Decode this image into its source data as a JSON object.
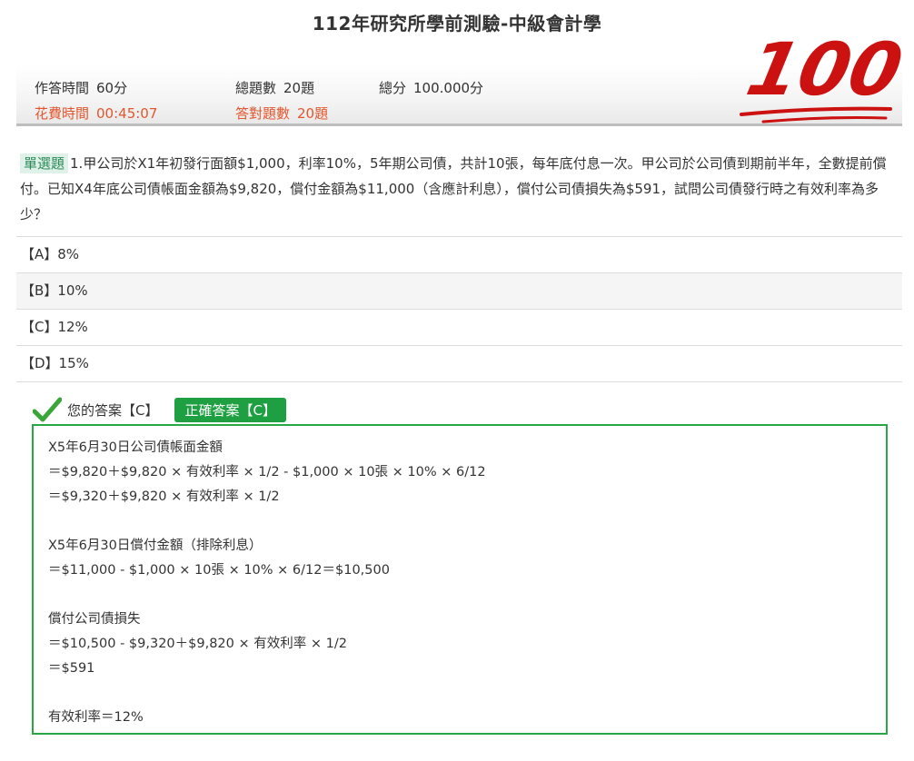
{
  "exam": {
    "title": "112年研究所學前測驗-中級會計學"
  },
  "info": {
    "answer_time_label": "作答時間",
    "answer_time_value": "60分",
    "total_questions_label": "總題數",
    "total_questions_value": "20題",
    "total_score_label": "總分",
    "total_score_value": "100.000分",
    "time_spent_label": "花費時間",
    "time_spent_value": "00:45:07",
    "correct_count_label": "答對題數",
    "correct_count_value": "20題"
  },
  "score": {
    "value": "100",
    "color": "#cc1111"
  },
  "question": {
    "type_label": "單選題",
    "number": "1.",
    "text": "甲公司於X1年初發行面額$1,000，利率10%，5年期公司債，共計10張，每年底付息一次。甲公司於公司債到期前半年，全數提前償付。已知X4年底公司債帳面金額為$9,820，償付金額為$11,000（含應計利息），償付公司債損失為$591，試問公司債發行時之有效利率為多少？"
  },
  "options": [
    {
      "label": "【A】8%"
    },
    {
      "label": "【B】10%"
    },
    {
      "label": "【C】12%"
    },
    {
      "label": "【D】15%"
    }
  ],
  "answer": {
    "icon": "checkmark-icon",
    "your_answer": "您的答案【C】",
    "correct_answer": "正確答案【C】"
  },
  "explanation": {
    "lines": [
      "X5年6月30日公司債帳面金額",
      "＝$9,820＋$9,820 × 有效利率 × 1/2 - $1,000 × 10張 × 10% × 6/12",
      "＝$9,320＋$9,820 × 有效利率 × 1/2",
      "",
      "X5年6月30日償付金額（排除利息）",
      "＝$11,000 - $1,000 × 10張 × 10% × 6/12＝$10,500",
      "",
      "償付公司債損失",
      "＝$10,500 - $9,320＋$9,820 × 有效利率 × 1/2",
      "＝$591",
      "",
      "有效利率＝12%"
    ]
  },
  "colors": {
    "accent_orange": "#e2562d",
    "correct_green": "#1ea042",
    "badge_green_bg": "#dff1e8"
  }
}
